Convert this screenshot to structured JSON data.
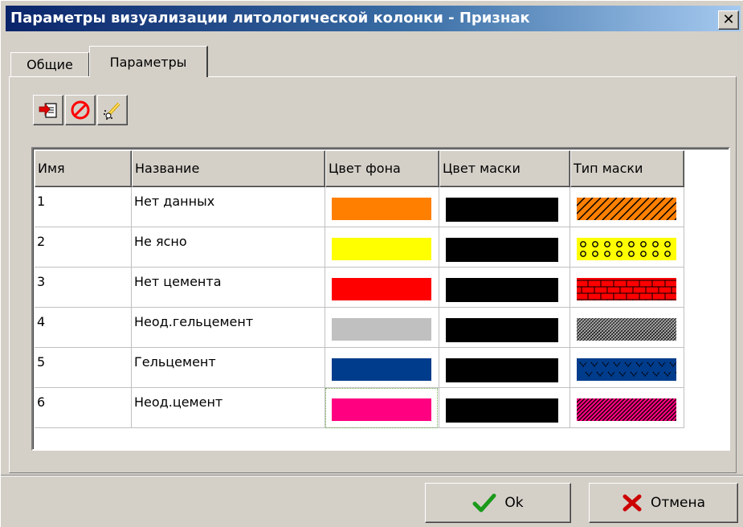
{
  "window": {
    "title": "Параметры визуализации литологической колонки - Признак",
    "close_glyph": "✕"
  },
  "tabs": [
    {
      "label": "Общие"
    },
    {
      "label": "Параметры"
    }
  ],
  "toolbar": {
    "icons": [
      "import-icon",
      "delete-icon",
      "edit-icon"
    ]
  },
  "table": {
    "columns": [
      "Имя",
      "Название",
      "Цвет фона",
      "Цвет маски",
      "Тип маски"
    ],
    "rows": [
      {
        "name": "1",
        "title": "Нет данных",
        "bg_color": "#ff8000",
        "mask_color": "#000000",
        "mask_type": "diagonal-hatch"
      },
      {
        "name": "2",
        "title": "Не ясно",
        "bg_color": "#ffff00",
        "mask_color": "#000000",
        "mask_type": "circles"
      },
      {
        "name": "3",
        "title": "Нет цемента",
        "bg_color": "#ff0000",
        "mask_color": "#000000",
        "mask_type": "bricks"
      },
      {
        "name": "4",
        "title": "Неод.гельцемент",
        "bg_color": "#c0c0c0",
        "mask_color": "#000000",
        "mask_type": "crosshatch"
      },
      {
        "name": "5",
        "title": "Гельцемент",
        "bg_color": "#003c8c",
        "mask_color": "#000000",
        "mask_type": "chevrons"
      },
      {
        "name": "6",
        "title": "Неод.цемент",
        "bg_color": "#ff0080",
        "mask_color": "#000000",
        "mask_type": "dense-hatch"
      }
    ]
  },
  "buttons": {
    "ok_label": "Ok",
    "cancel_label": "Отмена"
  }
}
